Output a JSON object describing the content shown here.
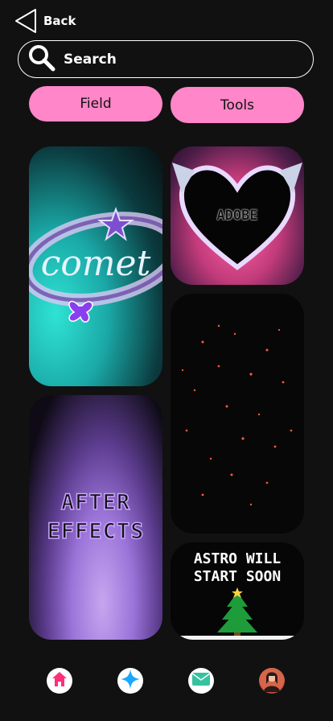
{
  "header": {
    "back_label": "Back",
    "search_label": "Search"
  },
  "filters": [
    {
      "label": "Field"
    },
    {
      "label": "Tools"
    }
  ],
  "cards": {
    "comet": {
      "text": "comet"
    },
    "adobe": {
      "text": "ADOBE"
    },
    "after": {
      "line1": "AFTER",
      "line2": "EFFECTS"
    },
    "astro": {
      "line1": "ASTRO WILL",
      "line2": "START SOON"
    }
  },
  "nav": {
    "items": [
      "home-icon",
      "sparkle-icon",
      "mail-icon",
      "profile-avatar"
    ]
  },
  "colors": {
    "accent_pink": "#ff86c8",
    "background": "#111111"
  }
}
